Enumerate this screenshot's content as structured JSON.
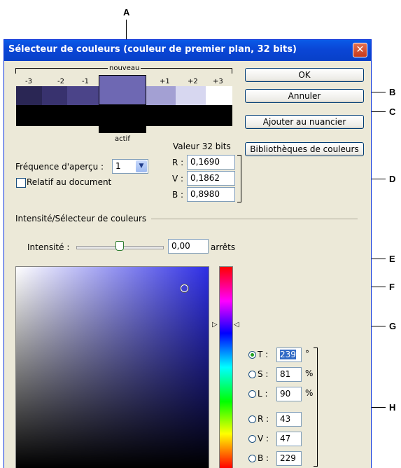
{
  "window": {
    "title": "Sélecteur de couleurs (couleur de premier plan, 32 bits)",
    "close_glyph": "✕"
  },
  "callouts": [
    "A",
    "B",
    "C",
    "D",
    "E",
    "F",
    "G",
    "H"
  ],
  "preview": {
    "nouveau_label": "nouveau",
    "actif_label": "actif",
    "steps": [
      "-3",
      "-2",
      "-1",
      "+1",
      "+2",
      "+3"
    ],
    "colors": {
      "m3": "#2a2654",
      "m2": "#38326e",
      "m1": "#4b4489",
      "nouveau": "#6e68b3",
      "p1": "#a3a0d3",
      "p2": "#d7d7f0",
      "p3": "#ffffff",
      "actif": "#000000"
    }
  },
  "buttons": {
    "ok": "OK",
    "cancel": "Annuler",
    "add_swatch": "Ajouter au nuancier",
    "libraries": "Bibliothèques de couleurs"
  },
  "frequency": {
    "label": "Fréquence d'aperçu :",
    "value": "1"
  },
  "relative": {
    "label": "Relatif au document",
    "checked": false
  },
  "value32": {
    "header": "Valeur 32 bits",
    "r_label": "R :",
    "r": "0,1690",
    "v_label": "V :",
    "v": "0,1862",
    "b_label": "B :",
    "b": "0,8980"
  },
  "section_label": "Intensité/Sélecteur de couleurs",
  "intensity": {
    "label": "Intensité :",
    "value": "0,00",
    "unit": "arrêts",
    "slider_level": 0.5
  },
  "picker": {
    "hue_color": "#2e2ee5",
    "hsl": [
      {
        "label": "T :",
        "value": "239",
        "unit": "°",
        "selected": true
      },
      {
        "label": "S :",
        "value": "81",
        "unit": "%",
        "selected": false
      },
      {
        "label": "L :",
        "value": "90",
        "unit": "%",
        "selected": false
      }
    ],
    "rvb": [
      {
        "label": "R :",
        "value": "43",
        "selected": false
      },
      {
        "label": "V :",
        "value": "47",
        "selected": false
      },
      {
        "label": "B :",
        "value": "229",
        "selected": false
      }
    ]
  }
}
